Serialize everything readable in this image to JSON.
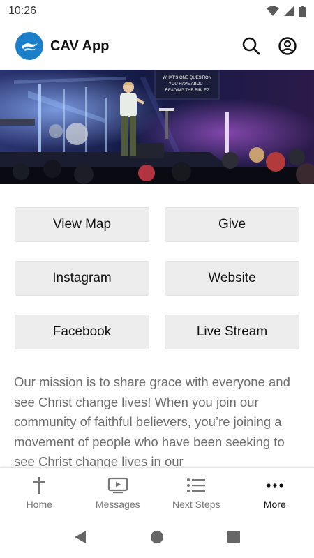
{
  "status_bar": {
    "time": "10:26"
  },
  "header": {
    "app_title": "CAV App"
  },
  "hero": {
    "screen_text": "WHAT'S ONE QUESTION YOU HAVE ABOUT READING THE BIBLE?"
  },
  "buttons": [
    {
      "label": "View Map"
    },
    {
      "label": "Give"
    },
    {
      "label": "Instagram"
    },
    {
      "label": "Website"
    },
    {
      "label": "Facebook"
    },
    {
      "label": "Live Stream"
    }
  ],
  "mission": {
    "text": "Our mission is to share grace with everyone and see Christ change lives! When you join our community of faithful believers, you’re joining a movement of people who have been seeking to see Christ change lives in our"
  },
  "bottom_nav": [
    {
      "label": "Home",
      "icon": "cross-icon"
    },
    {
      "label": "Messages",
      "icon": "tv-play-icon"
    },
    {
      "label": "Next Steps",
      "icon": "list-icon"
    },
    {
      "label": "More",
      "icon": "more-dots-icon",
      "active": true
    }
  ],
  "colors": {
    "brand": "#1a7fc8",
    "tile_bg": "#ededee",
    "muted_text": "#6d6d6d"
  }
}
